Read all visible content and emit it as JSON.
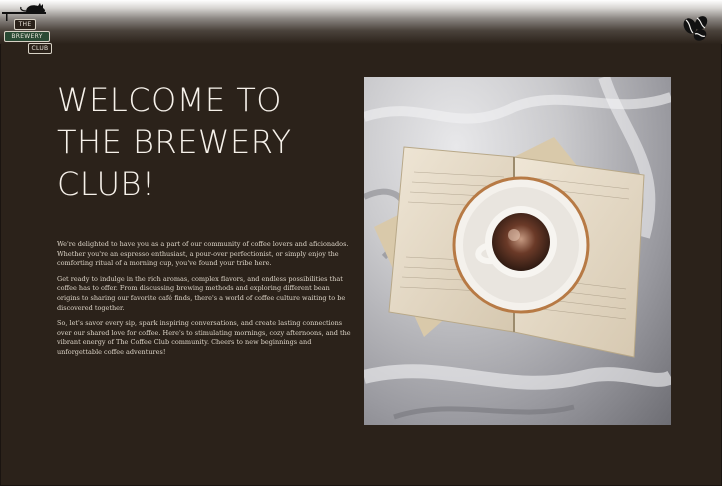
{
  "logo": {
    "line1": "THE",
    "line2": "BREWERY",
    "line3": "CLUB"
  },
  "icons": {
    "logo_cat": "cat-icon",
    "beans": "coffee-beans-icon"
  },
  "hero": {
    "title_line1": "WELCOME TO",
    "title_line2": "THE BREWERY",
    "title_line3": "CLUB!"
  },
  "intro": {
    "p1": "We're delighted to have you as a part of our community of coffee lovers and aficionados. Whether you're an espresso enthusiast, a pour-over perfectionist, or simply enjoy the comforting ritual of a morning cup, you've found your tribe here.",
    "p2": "Get ready to indulge in the rich aromas, complex flavors, and endless possibilities that coffee has to offer. From discussing brewing methods and exploring different bean origins to sharing our favorite café finds, there's a world of coffee culture waiting to be discovered together.",
    "p3": "So, let's savor every sip, spark inspiring conversations, and create lasting connections over our shared love for coffee. Here's to stimulating mornings, cozy afternoons, and the vibrant energy of The Coffee Club community. Cheers to new beginnings and unforgettable coffee adventures!"
  },
  "colors": {
    "background": "#2b221a",
    "text": "#f6f1ea",
    "accent_green": "#2a4a34"
  }
}
